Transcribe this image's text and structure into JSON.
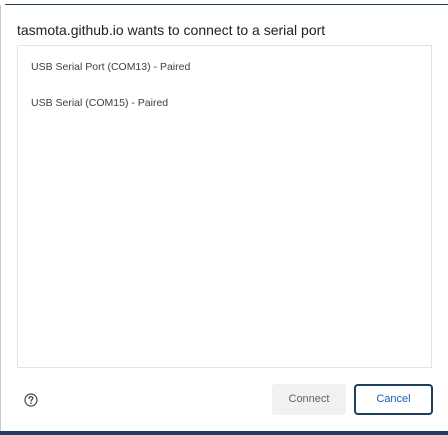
{
  "dialog": {
    "title": "tasmota.github.io wants to connect to a serial port",
    "devices": [
      {
        "label": "USB Serial Port (COM13) - Paired"
      },
      {
        "label": "USB Serial (COM15) - Paired"
      }
    ],
    "help_icon": "help-circle-icon",
    "buttons": {
      "connect_label": "Connect",
      "cancel_label": "Cancel"
    }
  },
  "colors": {
    "accent_border": "#1f3d5c",
    "cancel_text": "#1a5fb4",
    "connect_bg": "#f1f1f1"
  }
}
